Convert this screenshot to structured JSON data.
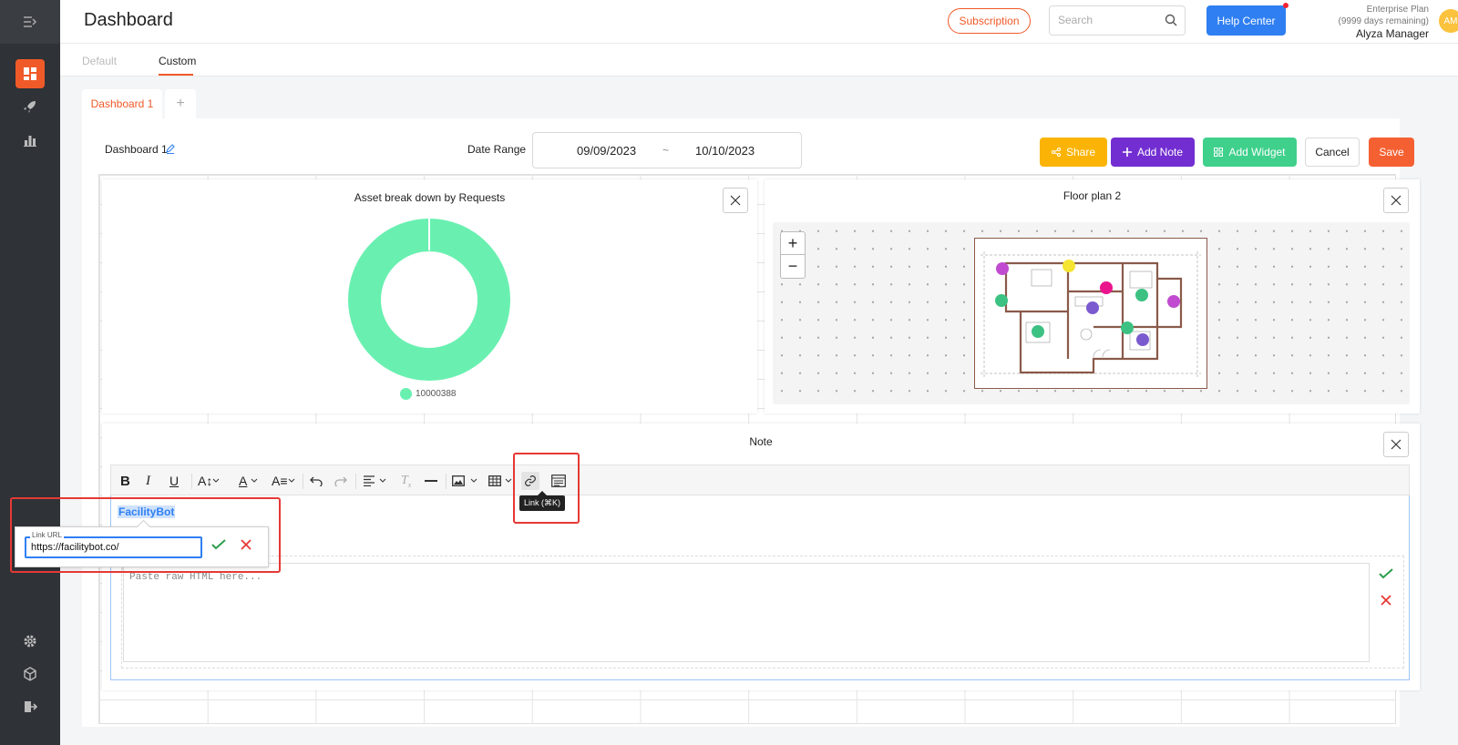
{
  "header": {
    "title": "Dashboard",
    "subscription_label": "Subscription",
    "search_placeholder": "Search",
    "help_label": "Help Center",
    "plan_name": "Enterprise Plan",
    "plan_remaining": "(9999 days remaining)",
    "user_name": "Alyza Manager",
    "avatar_initials": "AM"
  },
  "tabs": {
    "default_label": "Default",
    "custom_label": "Custom"
  },
  "dashboard_tab": {
    "label": "Dashboard 1",
    "add_label": "+"
  },
  "controls": {
    "dashboard_name": "Dashboard 1",
    "date_range_label": "Date Range",
    "start_date": "09/09/2023",
    "separator": "~",
    "end_date": "10/10/2023",
    "share_label": "Share",
    "add_note_label": "Add Note",
    "add_widget_label": "Add Widget",
    "cancel_label": "Cancel",
    "save_label": "Save"
  },
  "asset_widget": {
    "title": "Asset break down by Requests",
    "legend_label": "10000388",
    "color": "#69f0b0"
  },
  "floorplan_widget": {
    "title": "Floor plan 2",
    "zoom_in": "+",
    "zoom_out": "−"
  },
  "note_widget": {
    "title": "Note",
    "selected_text": "FacilityBot",
    "raw_placeholder": "Paste raw HTML here...",
    "tooltip": "Link (⌘K)",
    "link_url_label": "Link URL",
    "link_url_value": "https://facilitybot.co/"
  },
  "colors": {
    "accent": "#f05a28",
    "help": "#2f7ff2",
    "share": "#fbb406",
    "note": "#722ed1",
    "widget": "#3fd08c",
    "save": "#f56032"
  }
}
